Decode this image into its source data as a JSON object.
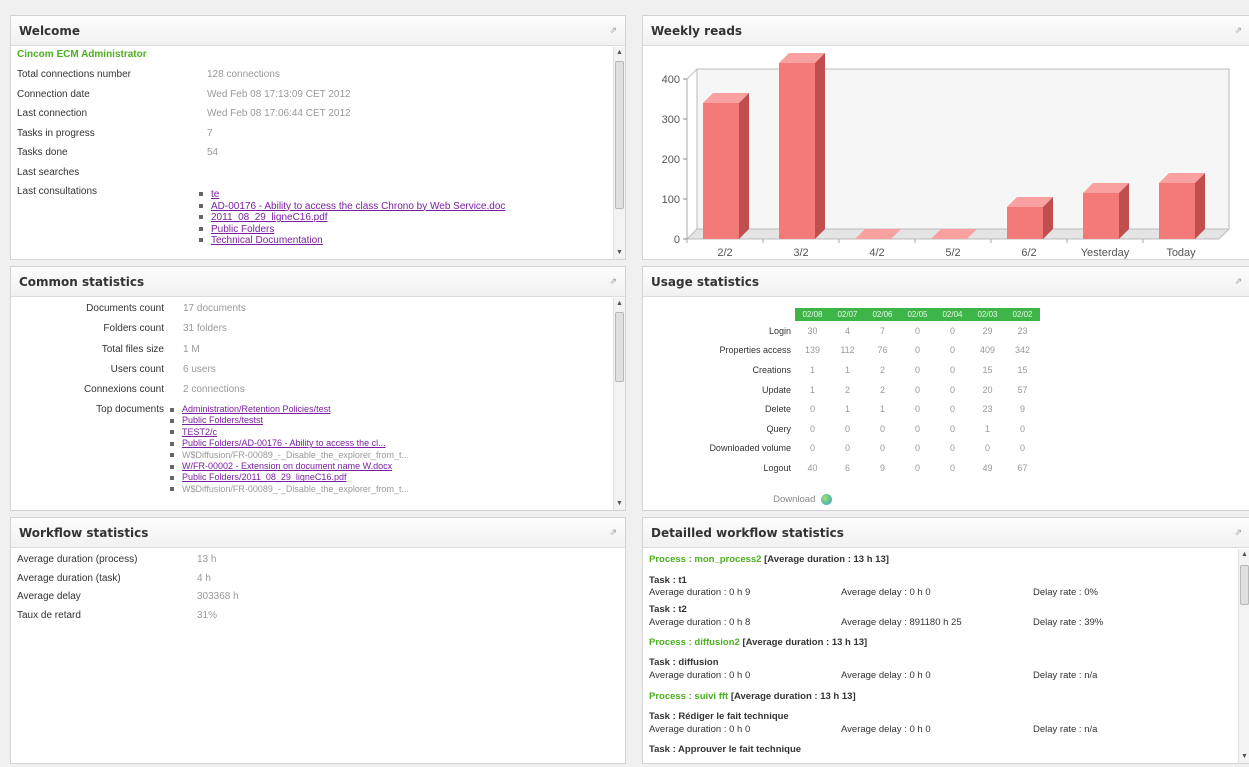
{
  "welcome": {
    "title": "Welcome",
    "user": "Cincom ECM Administrator",
    "rows": [
      {
        "label": "Total connections number",
        "value": "128 connections"
      },
      {
        "label": "Connection date",
        "value": "Wed Feb 08 17:13:09 CET 2012"
      },
      {
        "label": "Last connection",
        "value": "Wed Feb 08 17:06:44 CET 2012"
      },
      {
        "label": "Tasks in progress",
        "value": "7"
      },
      {
        "label": "Tasks done",
        "value": "54"
      },
      {
        "label": "Last searches",
        "value": ""
      },
      {
        "label": "Last consultations",
        "value": ""
      }
    ],
    "consultations": [
      "te",
      "AD-00176 - Ability to access the class Chrono by Web Service.doc",
      "2011_08_29_ligneC16.pdf",
      "Public Folders",
      "Technical Documentation"
    ]
  },
  "weekly": {
    "title": "Weekly reads"
  },
  "chart_data": {
    "type": "bar",
    "title": "Weekly reads",
    "categories": [
      "2/2",
      "3/2",
      "4/2",
      "5/2",
      "6/2",
      "Yesterday",
      "Today"
    ],
    "values": [
      340,
      440,
      0,
      0,
      80,
      115,
      140
    ],
    "ylim": [
      0,
      400
    ],
    "yticks": [
      "0",
      "100",
      "200",
      "300",
      "400"
    ],
    "color": "#f47a7a",
    "xlabel": "",
    "ylabel": "",
    "grid": false
  },
  "common": {
    "title": "Common statistics",
    "rows": [
      {
        "label": "Documents count",
        "value": "17 documents"
      },
      {
        "label": "Folders count",
        "value": "31 folders"
      },
      {
        "label": "Total files size",
        "value": "1 M"
      },
      {
        "label": "Users count",
        "value": "6 users"
      },
      {
        "label": "Connexions count",
        "value": "2 connections"
      }
    ],
    "top_label": "Top documents",
    "top_docs": [
      {
        "text": "Administration/Retention Policies/test",
        "link": true
      },
      {
        "text": "Public Folders/testst",
        "link": true
      },
      {
        "text": "TEST2/c",
        "link": true
      },
      {
        "text": "Public Folders/AD-00176 - Ability to access the cl...",
        "link": true
      },
      {
        "text": "W$Diffusion/FR-00089_-_Disable_the_explorer_from_t...",
        "link": false
      },
      {
        "text": "W/FR-00002 - Extension on document name W.docx",
        "link": true
      },
      {
        "text": "Public Folders/2011_08_29_ligneC16.pdf",
        "link": true
      },
      {
        "text": "W$Diffusion/FR-00089_-_Disable_the_explorer_from_t...",
        "link": false
      }
    ]
  },
  "usage": {
    "title": "Usage statistics",
    "dates": [
      "02/08",
      "02/07",
      "02/06",
      "02/05",
      "02/04",
      "02/03",
      "02/02"
    ],
    "rows": [
      {
        "label": "Login",
        "values": [
          "30",
          "4",
          "7",
          "0",
          "0",
          "29",
          "23"
        ]
      },
      {
        "label": "Properties access",
        "values": [
          "139",
          "112",
          "76",
          "0",
          "0",
          "409",
          "342"
        ]
      },
      {
        "label": "Creations",
        "values": [
          "1",
          "1",
          "2",
          "0",
          "0",
          "15",
          "15"
        ]
      },
      {
        "label": "Update",
        "values": [
          "1",
          "2",
          "2",
          "0",
          "0",
          "20",
          "57"
        ]
      },
      {
        "label": "Delete",
        "values": [
          "0",
          "1",
          "1",
          "0",
          "0",
          "23",
          "9"
        ]
      },
      {
        "label": "Query",
        "values": [
          "0",
          "0",
          "0",
          "0",
          "0",
          "1",
          "0"
        ]
      },
      {
        "label": "Downloaded volume",
        "values": [
          "0",
          "0",
          "0",
          "0",
          "0",
          "0",
          "0"
        ]
      },
      {
        "label": "Logout",
        "values": [
          "40",
          "6",
          "9",
          "0",
          "0",
          "49",
          "67"
        ]
      }
    ],
    "download": "Download"
  },
  "workflow": {
    "title": "Workflow statistics",
    "rows": [
      {
        "label": "Average duration (process)",
        "value": "13 h"
      },
      {
        "label": "Average duration (task)",
        "value": "4 h"
      },
      {
        "label": "Average delay",
        "value": "303368 h"
      },
      {
        "label": "Taux de retard",
        "value": "31%"
      }
    ]
  },
  "detailed": {
    "title": "Detailled workflow statistics",
    "p1": {
      "name": "Process : mon_process2",
      "avg": "[Average duration : 13 h 13]"
    },
    "t1": {
      "name": "Task : t1",
      "dur": "Average duration : 0 h 9",
      "delay": "Average delay : 0 h 0",
      "rate": "Delay rate : 0%"
    },
    "t2": {
      "name": "Task : t2",
      "dur": "Average duration : 0 h 8",
      "delay": "Average delay : 891180 h 25",
      "rate": "Delay rate : 39%"
    },
    "p2": {
      "name": "Process : diffusion2",
      "avg": "[Average duration : 13 h 13]"
    },
    "t3": {
      "name": "Task : diffusion",
      "dur": "Average duration : 0 h 0",
      "delay": "Average delay : 0 h 0",
      "rate": "Delay rate : n/a"
    },
    "p3": {
      "name": "Process : suivi fft",
      "avg": "[Average duration : 13 h 13]"
    },
    "t4": {
      "name": "Task : Rédiger le fait technique",
      "dur": "Average duration : 0 h 0",
      "delay": "Average delay : 0 h 0",
      "rate": "Delay rate : n/a"
    },
    "t5": {
      "name": "Task : Approuver le fait technique"
    }
  }
}
